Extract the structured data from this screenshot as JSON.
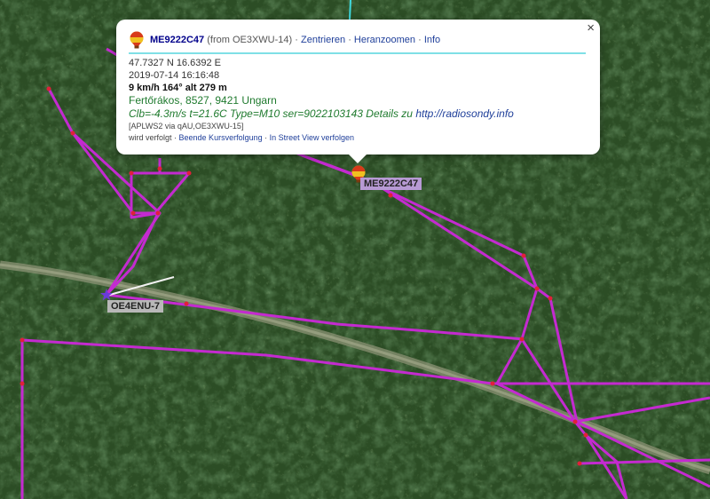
{
  "popup": {
    "callsign": "ME9222C47",
    "from_text": "(from OE3XWU-14)",
    "separator": "·",
    "actions": [
      "Zentrieren",
      "Heranzoomen",
      "Info"
    ],
    "close_label": "×",
    "coordinates": "47.7327 N 16.6392 E",
    "timestamp": "2019-07-14 16:16:48",
    "speed_course_alt": "9 km/h 164° alt 279 m",
    "location": "Fertőrákos, 8527, 9421 Ungarn",
    "telemetry": "Clb=-4.3m/s t=21.6C Type=M10 ser=9022103143 Details zu",
    "telemetry_url": "http://radiosondy.info",
    "path": "[APLWS2 via qAU,OE3XWU-15]",
    "status_prefix": "wird verfolgt ·",
    "status_links": [
      "Beende Kursverfolgung",
      "In Street View verfolgen"
    ]
  },
  "markers": [
    {
      "label": "ME9222C47",
      "icon": "balloon-icon"
    },
    {
      "label": "OE4ENU-7",
      "icon": "station-icon"
    }
  ],
  "colors": {
    "track": "#c42ad0",
    "track_point": "#e0203a",
    "label_bg_balloon": "#b79ad4",
    "label_bg_station": "#b8b8b8",
    "forest_dark": "#1d3a1a",
    "forest_mid": "#2f5a27",
    "path_light": "#8a9a7a"
  }
}
